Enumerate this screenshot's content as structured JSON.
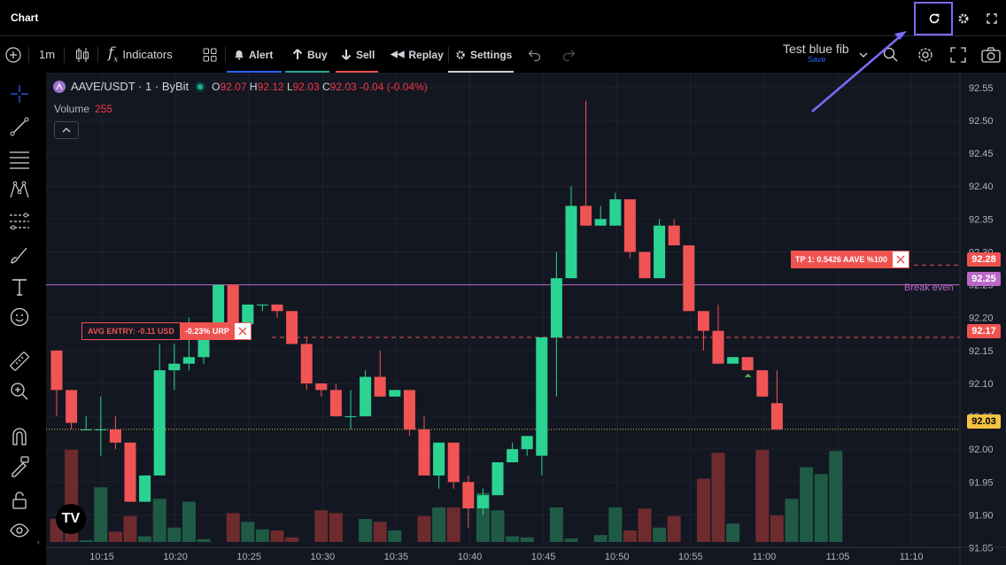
{
  "window": {
    "title": "Chart"
  },
  "toolbar": {
    "interval": "1m",
    "indicators_label": "Indicators",
    "alert_label": "Alert",
    "buy_label": "Buy",
    "sell_label": "Sell",
    "replay_label": "Replay",
    "settings_label": "Settings",
    "layout_name": "Test blue fib",
    "layout_save": "Save"
  },
  "legend": {
    "symbol": "AAVE/USDT · 1 · ByBit",
    "open_label": "O",
    "open": "92.07",
    "high_label": "H",
    "high": "92.12",
    "low_label": "L",
    "low": "92.03",
    "close_label": "C",
    "close": "92.03",
    "change": "-0.04 (-0.04%)",
    "volume_label": "Volume",
    "volume_value": "255"
  },
  "orders": {
    "avg_entry_label": "AVG ENTRY: -0.11 USD",
    "urp_label": "-0.23% URP",
    "tp_label": "TP 1: 0.5426 AAVE %100",
    "break_even_label": "Break even"
  },
  "price_tags": {
    "tp": "92.28",
    "break_even": "92.25",
    "entry": "92.17",
    "last": "92.03"
  },
  "colors": {
    "up": "#26a69a",
    "down": "#ef5350",
    "up_bright": "#2bd392",
    "down_bright": "#f05454",
    "break_even": "#ba68c8",
    "highlight": "#7b6cf6"
  },
  "chart_data": {
    "type": "candlestick",
    "symbol": "AAVE/USDT",
    "interval": "1",
    "exchange": "ByBit",
    "price_axis": [
      "92.55",
      "92.50",
      "92.45",
      "92.40",
      "92.35",
      "92.30",
      "92.25",
      "92.20",
      "92.15",
      "92.10",
      "92.05",
      "92.00",
      "91.95",
      "91.90",
      "91.85"
    ],
    "time_axis": [
      "10:15",
      "10:20",
      "10:25",
      "10:30",
      "10:35",
      "10:40",
      "10:45",
      "10:50",
      "10:55",
      "11:00",
      "11:05",
      "11:10"
    ],
    "ylim": [
      91.84,
      92.57
    ],
    "candles": [
      {
        "t": "10:12",
        "o": 92.15,
        "h": 92.15,
        "l": 92.05,
        "c": 92.09
      },
      {
        "t": "10:13",
        "o": 92.09,
        "h": 92.09,
        "l": 92.03,
        "c": 92.04
      },
      {
        "t": "10:14",
        "o": 92.03,
        "h": 92.05,
        "l": 92.03,
        "c": 92.03
      },
      {
        "t": "10:15",
        "o": 92.03,
        "h": 92.08,
        "l": 91.99,
        "c": 92.03
      },
      {
        "t": "10:16",
        "o": 92.03,
        "h": 92.05,
        "l": 92.0,
        "c": 92.01
      },
      {
        "t": "10:17",
        "o": 92.01,
        "h": 92.01,
        "l": 91.92,
        "c": 91.92
      },
      {
        "t": "10:18",
        "o": 91.92,
        "h": 91.96,
        "l": 91.92,
        "c": 91.96
      },
      {
        "t": "10:19",
        "o": 91.96,
        "h": 92.16,
        "l": 91.96,
        "c": 92.12
      },
      {
        "t": "10:20",
        "o": 92.12,
        "h": 92.16,
        "l": 92.09,
        "c": 92.13
      },
      {
        "t": "10:21",
        "o": 92.13,
        "h": 92.2,
        "l": 92.12,
        "c": 92.14
      },
      {
        "t": "10:22",
        "o": 92.14,
        "h": 92.18,
        "l": 92.13,
        "c": 92.17
      },
      {
        "t": "10:23",
        "o": 92.18,
        "h": 92.25,
        "l": 92.17,
        "c": 92.25
      },
      {
        "t": "10:24",
        "o": 92.25,
        "h": 92.25,
        "l": 92.17,
        "c": 92.19
      },
      {
        "t": "10:25",
        "o": 92.19,
        "h": 92.22,
        "l": 92.19,
        "c": 92.22
      },
      {
        "t": "10:26",
        "o": 92.22,
        "h": 92.22,
        "l": 92.21,
        "c": 92.22
      },
      {
        "t": "10:27",
        "o": 92.22,
        "h": 92.22,
        "l": 92.2,
        "c": 92.21
      },
      {
        "t": "10:28",
        "o": 92.21,
        "h": 92.21,
        "l": 92.16,
        "c": 92.16
      },
      {
        "t": "10:29",
        "o": 92.16,
        "h": 92.17,
        "l": 92.09,
        "c": 92.1
      },
      {
        "t": "10:30",
        "o": 92.1,
        "h": 92.1,
        "l": 92.08,
        "c": 92.09
      },
      {
        "t": "10:31",
        "o": 92.09,
        "h": 92.1,
        "l": 92.05,
        "c": 92.05
      },
      {
        "t": "10:32",
        "o": 92.05,
        "h": 92.09,
        "l": 92.03,
        "c": 92.05
      },
      {
        "t": "10:33",
        "o": 92.05,
        "h": 92.12,
        "l": 92.05,
        "c": 92.11
      },
      {
        "t": "10:34",
        "o": 92.11,
        "h": 92.15,
        "l": 92.08,
        "c": 92.08
      },
      {
        "t": "10:35",
        "o": 92.08,
        "h": 92.09,
        "l": 92.08,
        "c": 92.09
      },
      {
        "t": "10:36",
        "o": 92.09,
        "h": 92.09,
        "l": 92.02,
        "c": 92.03
      },
      {
        "t": "10:37",
        "o": 92.03,
        "h": 92.05,
        "l": 91.96,
        "c": 91.96
      },
      {
        "t": "10:38",
        "o": 91.96,
        "h": 92.01,
        "l": 91.94,
        "c": 92.01
      },
      {
        "t": "10:39",
        "o": 92.01,
        "h": 92.01,
        "l": 91.94,
        "c": 91.95
      },
      {
        "t": "10:40",
        "o": 91.95,
        "h": 91.96,
        "l": 91.88,
        "c": 91.91
      },
      {
        "t": "10:41",
        "o": 91.91,
        "h": 91.94,
        "l": 91.9,
        "c": 91.93
      },
      {
        "t": "10:42",
        "o": 91.93,
        "h": 91.98,
        "l": 91.93,
        "c": 91.98
      },
      {
        "t": "10:43",
        "o": 91.98,
        "h": 92.01,
        "l": 91.98,
        "c": 92.0
      },
      {
        "t": "10:44",
        "o": 92.0,
        "h": 92.02,
        "l": 91.99,
        "c": 92.02
      },
      {
        "t": "10:45",
        "o": 91.99,
        "h": 92.17,
        "l": 91.96,
        "c": 92.17
      },
      {
        "t": "10:46",
        "o": 92.17,
        "h": 92.3,
        "l": 92.08,
        "c": 92.26
      },
      {
        "t": "10:47",
        "o": 92.26,
        "h": 92.4,
        "l": 92.26,
        "c": 92.37
      },
      {
        "t": "10:48",
        "o": 92.37,
        "h": 92.53,
        "l": 92.34,
        "c": 92.34
      },
      {
        "t": "10:49",
        "o": 92.34,
        "h": 92.37,
        "l": 92.34,
        "c": 92.35
      },
      {
        "t": "10:50",
        "o": 92.34,
        "h": 92.39,
        "l": 92.34,
        "c": 92.38
      },
      {
        "t": "10:51",
        "o": 92.38,
        "h": 92.38,
        "l": 92.29,
        "c": 92.3
      },
      {
        "t": "10:52",
        "o": 92.3,
        "h": 92.3,
        "l": 92.26,
        "c": 92.26
      },
      {
        "t": "10:53",
        "o": 92.26,
        "h": 92.35,
        "l": 92.26,
        "c": 92.34
      },
      {
        "t": "10:54",
        "o": 92.34,
        "h": 92.35,
        "l": 92.31,
        "c": 92.31
      },
      {
        "t": "10:55",
        "o": 92.31,
        "h": 92.31,
        "l": 92.21,
        "c": 92.21
      },
      {
        "t": "10:56",
        "o": 92.21,
        "h": 92.21,
        "l": 92.15,
        "c": 92.18
      },
      {
        "t": "10:57",
        "o": 92.18,
        "h": 92.22,
        "l": 92.13,
        "c": 92.13
      },
      {
        "t": "10:58",
        "o": 92.13,
        "h": 92.14,
        "l": 92.13,
        "c": 92.14
      },
      {
        "t": "10:59",
        "o": 92.14,
        "h": 92.14,
        "l": 92.12,
        "c": 92.12
      },
      {
        "t": "11:00",
        "o": 92.12,
        "h": 92.12,
        "l": 92.08,
        "c": 92.08
      },
      {
        "t": "11:01",
        "o": 92.07,
        "h": 92.12,
        "l": 92.03,
        "c": 92.03
      }
    ],
    "volume_max": 200,
    "volume": [
      40,
      160,
      3,
      95,
      18,
      45,
      10,
      75,
      25,
      70,
      5,
      0,
      50,
      35,
      22,
      20,
      8,
      0,
      55,
      50,
      0,
      40,
      35,
      20,
      0,
      45,
      60,
      60,
      0,
      85,
      55,
      10,
      8,
      0,
      60,
      6,
      0,
      12,
      60,
      20,
      58,
      25,
      45,
      0,
      110,
      155,
      32,
      0,
      160,
      46,
      75,
      130,
      118,
      158
    ]
  }
}
